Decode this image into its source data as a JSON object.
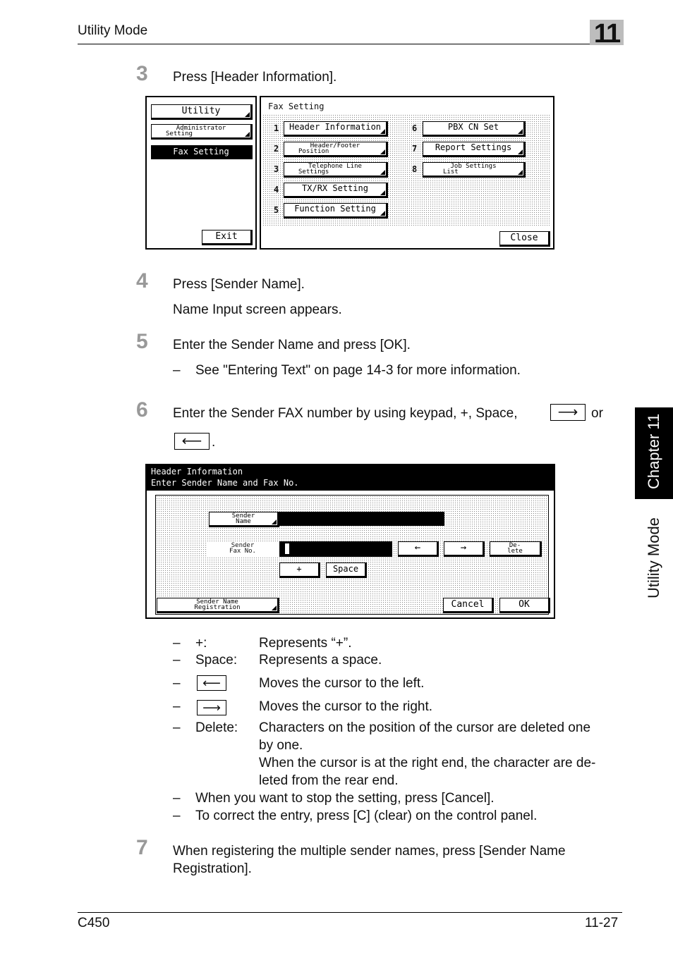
{
  "header": {
    "title": "Utility Mode",
    "chapter_number": "11"
  },
  "side": {
    "chapter_tab": "Chapter 11",
    "section": "Utility Mode"
  },
  "steps": [
    {
      "num": "3",
      "text": "Press [Header Information]."
    },
    {
      "num": "4",
      "text": "Press [Sender Name].",
      "sub": "Name Input screen appears."
    },
    {
      "num": "5",
      "text": "Enter the Sender Name and press [OK].",
      "bullet": "See \"Entering Text\" on page 14-3 for more information."
    },
    {
      "num": "6",
      "text_before": "Enter the Sender FAX number by using keypad, +, Space,",
      "text_after": "or",
      "period": "."
    },
    {
      "num": "7",
      "text": "When registering the multiple sender names, press [Sender Name",
      "text2": "Registration]."
    }
  ],
  "screen1": {
    "left": {
      "utility": "Utility",
      "admin_l1": "Administrator",
      "admin_l2": "Setting",
      "fax_setting": "Fax Setting",
      "exit": "Exit"
    },
    "title": "Fax Setting",
    "items": [
      {
        "n": "1",
        "label": "Header Information"
      },
      {
        "n": "2",
        "l1": "Header/Footer",
        "l2": "Position"
      },
      {
        "n": "3",
        "l1": "Telephone Line",
        "l2": "Settings"
      },
      {
        "n": "4",
        "label": "TX/RX Setting"
      },
      {
        "n": "5",
        "label": "Function Setting"
      },
      {
        "n": "6",
        "label": "PBX CN Set"
      },
      {
        "n": "7",
        "label": "Report Settings"
      },
      {
        "n": "8",
        "l1": "Job Settings",
        "l2": "List"
      }
    ],
    "close": "Close"
  },
  "screen2": {
    "title1": "Header Information",
    "title2": "Enter Sender Name and Fax No.",
    "sender_name_l1": "Sender",
    "sender_name_l2": "Name",
    "sender_fax_l1": "Sender",
    "sender_fax_l2": "Fax No.",
    "left_arrow": "←",
    "right_arrow": "→",
    "delete_l1": "De-",
    "delete_l2": "lete",
    "plus": "+",
    "space": "Space",
    "reg_l1": "Sender Name",
    "reg_l2": "Registration",
    "cancel": "Cancel",
    "ok": "OK"
  },
  "legend": [
    {
      "key": "+:",
      "desc": "Represents “+”."
    },
    {
      "key": "Space:",
      "desc": "Represents a space."
    },
    {
      "icon": "←",
      "desc": "Moves the cursor to the left."
    },
    {
      "icon": "→",
      "desc": "Moves the cursor to the right."
    },
    {
      "key": "Delete:",
      "desc1": "Characters on the position of the cursor are deleted one",
      "desc2": "by one.",
      "desc3": "When the cursor is at the right end, the character are de-",
      "desc4": "leted from the rear end."
    }
  ],
  "notes": [
    "When you want to stop the setting, press [Cancel].",
    "To correct the entry, press [C] (clear) on the control panel."
  ],
  "dash": "–",
  "footer": {
    "model": "C450",
    "page": "11-27"
  }
}
